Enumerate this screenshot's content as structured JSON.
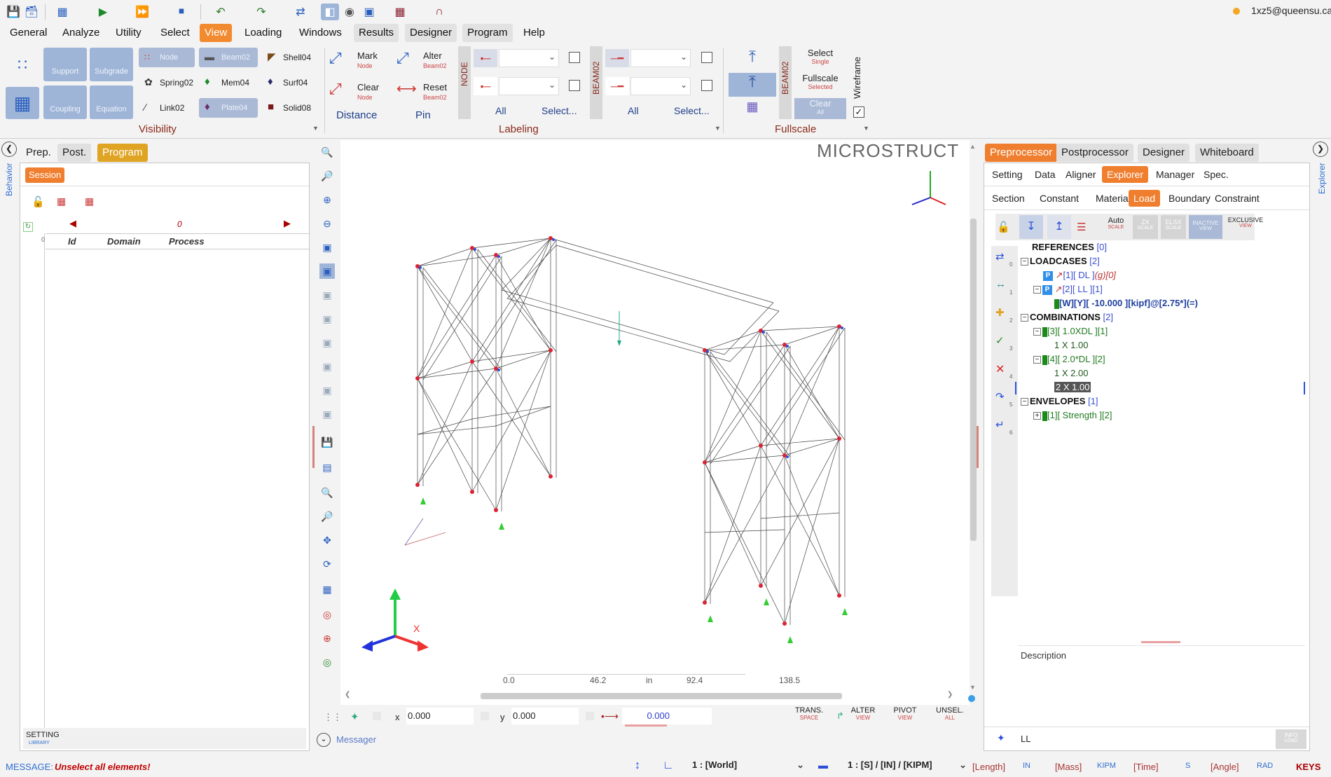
{
  "user": {
    "email": "1xz5@queensu.ca",
    "status_color": "#f5a623"
  },
  "menu": [
    "General",
    "Analyze",
    "Utility",
    "Select",
    "View",
    "Loading",
    "Windows",
    "Results",
    "Designer",
    "Program",
    "Help"
  ],
  "ribbon": {
    "visibility": {
      "buttons": [
        "Support",
        "Subgrade",
        "Node",
        "Beam02",
        "Shell04",
        "Spring02",
        "Mem04",
        "Surf04",
        "Coupling",
        "Equation",
        "Link02",
        "Plate04",
        "Solid08"
      ],
      "group_label": "Visibility"
    },
    "distance_pin": {
      "mark": "Mark",
      "mark_sub": "Node",
      "clear": "Clear",
      "clear_sub": "Node",
      "alter": "Alter",
      "alter_sub": "Beam02",
      "reset": "Reset",
      "reset_sub": "Beam02",
      "distance": "Distance",
      "pin": "Pin"
    },
    "labeling": {
      "node_tag": "NODE",
      "beam_tag": "BEAM02",
      "all1": "All",
      "select1": "Select...",
      "all2": "All",
      "select2": "Select...",
      "group_label": "Labeling"
    },
    "fullscale": {
      "beam_tag": "BEAM02",
      "select": "Select",
      "select_sub": "Single",
      "fullscale": "Fullscale",
      "fullscale_sub": "Selected",
      "clear": "Clear",
      "clear_sub": "All",
      "wireframe": "Wireframe",
      "group_label": "Fullscale"
    }
  },
  "left": {
    "side_label": "Behavior",
    "tabs": [
      "Prep.",
      "Post.",
      "Program"
    ],
    "session_tab": "Session",
    "nav_value": "0",
    "columns": [
      "Id",
      "Domain",
      "Process"
    ],
    "row_index": "0",
    "setting": "SETTING",
    "library": "LIBRARY"
  },
  "viewport": {
    "brand": "MICROSTRUCT",
    "ruler": [
      "0.0",
      "46.2",
      "in",
      "92.4",
      "138.5"
    ],
    "x_label": "x",
    "x_value": "0.000",
    "y_label": "y",
    "y_value": "0.000",
    "z_value": "0.000",
    "trans": "TRANS.",
    "trans_sub": "SPACE",
    "alter": "ALTER",
    "alter_sub": "VIEW",
    "pivot": "PIVOT",
    "pivot_sub": "VIEW",
    "unsel": "UNSEL.",
    "unsel_sub": "ALL",
    "messager": "Messager"
  },
  "right": {
    "side_label": "Explorer",
    "tabs": [
      "Preprocessor",
      "Postprocessor",
      "Designer",
      "Whiteboard"
    ],
    "subtabs": [
      "Setting",
      "Data",
      "Aligner",
      "Explorer",
      "Manager",
      "Spec."
    ],
    "subtabs2": [
      "Section",
      "Constant",
      "Material",
      "Load",
      "Boundary",
      "Constraint"
    ],
    "toolbar": {
      "auto": "Auto",
      "auto_sub": "SCALE",
      "zx": "ZX",
      "zx_sub": "SCALE",
      "ex": "ELSX",
      "ex_sub": "SCALE",
      "inactive": "INACTIVE",
      "inactive_sub": "VIEW",
      "exclusive": "EXCLUSIVE",
      "exclusive_sub": "VIEW"
    },
    "tree": {
      "references": "REFERENCES",
      "references_count": "[0]",
      "loadcases": "LOADCASES",
      "loadcases_count": "[2]",
      "lc1": "[1][ DL ]",
      "lc1_tail": "(g)[0]",
      "lc2": "[2][ LL ][1]",
      "lc2_load": "[W][Y][ -10.000 ][kipf]@[2.75*](=)",
      "combinations": "COMBINATIONS",
      "combinations_count": "[2]",
      "c3": "[3][ 1.0XDL ][1]",
      "c3_term": "1 X 1.00",
      "c4": "[4][ 2.0*DL ][2]",
      "c4_term1": "1 X 2.00",
      "c4_term2": "2 X 1.00",
      "envelopes": "ENVELOPES",
      "envelopes_count": "[1]",
      "env1": "[1][ Strength ][2]"
    },
    "row_numbers": [
      "0",
      "1",
      "2",
      "3",
      "4",
      "5",
      "6"
    ],
    "description": "Description",
    "footer_label": "LL",
    "info": "INFO",
    "info_sub": "LOAD"
  },
  "status": {
    "message_label": "MESSAGE:",
    "message": "Unselect all elements!",
    "coord_system": "1 : [World]",
    "units": "1 : [S] / [IN] / [KIPM]",
    "length_label": "[Length]",
    "length": "IN",
    "mass_label": "[Mass]",
    "mass": "KIPM",
    "time_label": "[Time]",
    "time": "S",
    "angle_label": "[Angle]",
    "angle": "RAD",
    "keys": "KEYS"
  },
  "colors": {
    "accent": "#ef7f2f",
    "gold": "#e0a424",
    "message": "#c00000",
    "link": "#2f6fd0"
  }
}
